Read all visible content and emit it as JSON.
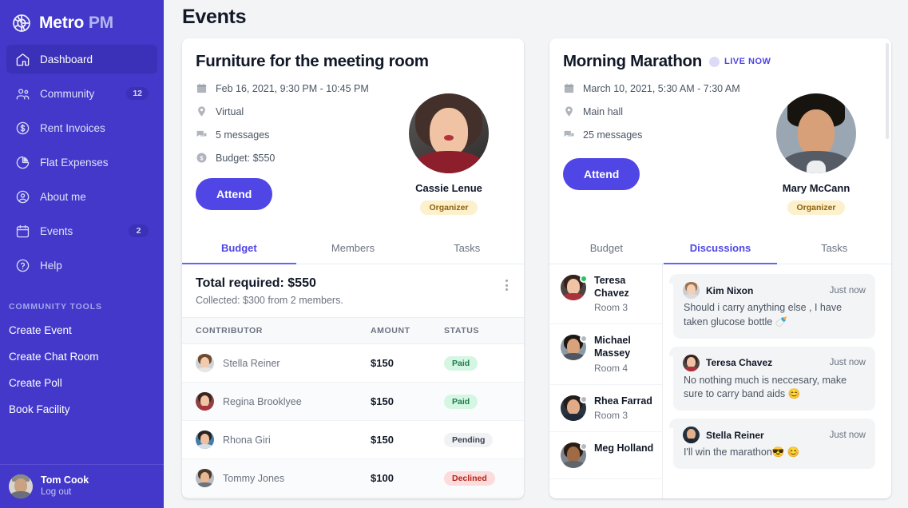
{
  "brand": {
    "name_bold": "Metro",
    "name_light": "PM",
    "logo_icon": "aperture-icon"
  },
  "sidebar": {
    "items": [
      {
        "label": "Dashboard",
        "icon": "home-icon",
        "badge": "",
        "active": true
      },
      {
        "label": "Community",
        "icon": "people-icon",
        "badge": "12",
        "active": false
      },
      {
        "label": "Rent Invoices",
        "icon": "dollar-circle-icon",
        "badge": "",
        "active": false
      },
      {
        "label": "Flat Expenses",
        "icon": "pie-chart-icon",
        "badge": "",
        "active": false
      },
      {
        "label": "About me",
        "icon": "user-circle-icon",
        "badge": "",
        "active": false
      },
      {
        "label": "Events",
        "icon": "calendar-icon",
        "badge": "2",
        "active": false
      },
      {
        "label": "Help",
        "icon": "question-circle-icon",
        "badge": "",
        "active": false
      }
    ],
    "tools_heading": "COMMUNITY TOOLS",
    "tools": [
      {
        "label": "Create Event"
      },
      {
        "label": "Create Chat Room"
      },
      {
        "label": "Create Poll"
      },
      {
        "label": "Book Facility"
      }
    ],
    "profile": {
      "name": "Tom Cook",
      "logout": "Log out"
    },
    "colors": {
      "bg": "#4338ca",
      "active_bg": "#3b30b8",
      "heading": "#a3a6ee"
    }
  },
  "main": {
    "page_title": "Events"
  },
  "cards": [
    {
      "title": "Furniture for the meeting room",
      "live": false,
      "live_label": "",
      "meta": [
        {
          "icon": "calendar-icon",
          "text": "Feb 16, 2021, 9:30 PM - 10:45 PM"
        },
        {
          "icon": "location-pin-icon",
          "text": "Virtual"
        },
        {
          "icon": "chat-bubbles-icon",
          "text": "5 messages"
        },
        {
          "icon": "dollar-circle-icon",
          "text": "Budget: $550"
        }
      ],
      "attend_label": "Attend",
      "organizer": {
        "name": "Cassie Lenue",
        "tag": "Organizer"
      },
      "tabs": [
        {
          "label": "Budget",
          "active": true
        },
        {
          "label": "Members",
          "active": false
        },
        {
          "label": "Tasks",
          "active": false
        }
      ],
      "budget": {
        "total_label": "Total required: $550",
        "collected_label": "Collected: $300 from 2 members.",
        "menu_icon": "more-vertical-icon",
        "columns": [
          "CONTRIBUTOR",
          "AMOUNT",
          "STATUS"
        ],
        "rows": [
          {
            "name": "Stella Reiner",
            "amount": "$150",
            "status": "Paid",
            "status_kind": "paid"
          },
          {
            "name": "Regina Brooklyee",
            "amount": "$150",
            "status": "Paid",
            "status_kind": "paid"
          },
          {
            "name": "Rhona Giri",
            "amount": "$150",
            "status": "Pending",
            "status_kind": "pending"
          },
          {
            "name": "Tommy Jones",
            "amount": "$100",
            "status": "Declined",
            "status_kind": "declined"
          }
        ]
      }
    },
    {
      "title": "Morning Marathon",
      "live": true,
      "live_label": "LIVE NOW",
      "meta": [
        {
          "icon": "calendar-icon",
          "text": "March 10, 2021, 5:30 AM - 7:30 AM"
        },
        {
          "icon": "location-pin-icon",
          "text": "Main hall"
        },
        {
          "icon": "chat-bubbles-icon",
          "text": "25 messages"
        }
      ],
      "attend_label": "Attend",
      "organizer": {
        "name": "Mary McCann",
        "tag": "Organizer"
      },
      "tabs": [
        {
          "label": "Budget",
          "active": false
        },
        {
          "label": "Discussions",
          "active": true
        },
        {
          "label": "Tasks",
          "active": false
        }
      ],
      "discussions": {
        "members": [
          {
            "name": "Teresa Chavez",
            "room": "Room 3",
            "online": true
          },
          {
            "name": "Michael Massey",
            "room": "Room 4",
            "online": false
          },
          {
            "name": "Rhea Farrad",
            "room": "Room 3",
            "online": false
          },
          {
            "name": "Meg Holland",
            "room": "",
            "online": false
          }
        ],
        "messages": [
          {
            "author": "Kim Nixon",
            "time": "Just now",
            "text": "Should i carry anything else , I have taken glucose bottle 🍼"
          },
          {
            "author": "Teresa Chavez",
            "time": "Just now",
            "text": "No nothing much is neccesary, make sure to carry band aids 😊"
          },
          {
            "author": "Stella Reiner",
            "time": "Just now",
            "text": "I'll win the marathon😎 😊"
          }
        ]
      }
    }
  ],
  "theme": {
    "accent": "#4f46e5",
    "page_bg": "#f3f4f6",
    "card_bg": "#ffffff",
    "status_paid_bg": "#d4f6e2",
    "status_pending_bg": "#f1f2f4",
    "status_declined_bg": "#fcdcdd",
    "organizer_tag_bg": "#fdf0cc"
  }
}
